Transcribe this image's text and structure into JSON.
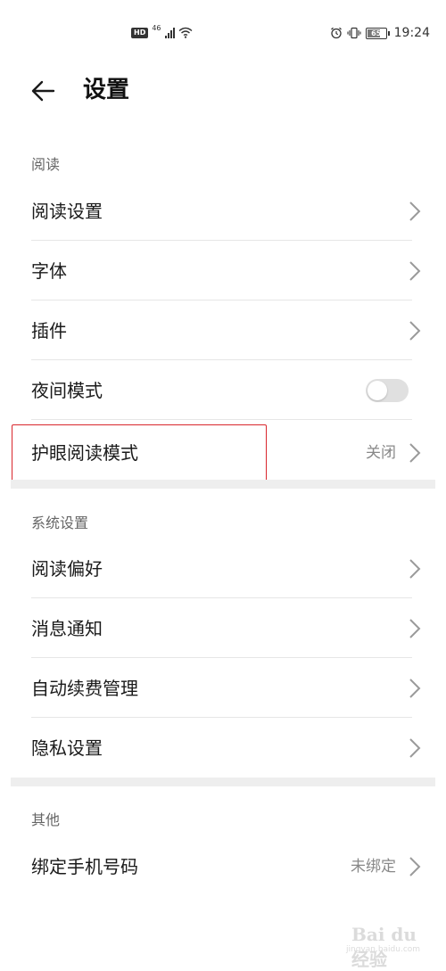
{
  "status_bar": {
    "hd": "HD",
    "network": "46",
    "battery_level": "65",
    "time": "19:24"
  },
  "header": {
    "title": "设置"
  },
  "sections": [
    {
      "label": "阅读",
      "items": [
        {
          "label": "阅读设置",
          "type": "nav"
        },
        {
          "label": "字体",
          "type": "nav"
        },
        {
          "label": "插件",
          "type": "nav"
        },
        {
          "label": "夜间模式",
          "type": "toggle",
          "on": false
        },
        {
          "label": "护眼阅读模式",
          "type": "nav",
          "value": "关闭",
          "highlighted": true
        }
      ]
    },
    {
      "label": "系统设置",
      "items": [
        {
          "label": "阅读偏好",
          "type": "nav"
        },
        {
          "label": "消息通知",
          "type": "nav"
        },
        {
          "label": "自动续费管理",
          "type": "nav"
        },
        {
          "label": "隐私设置",
          "type": "nav"
        }
      ]
    },
    {
      "label": "其他",
      "items": [
        {
          "label": "绑定手机号码",
          "type": "nav",
          "value": "未绑定"
        }
      ]
    }
  ],
  "colors": {
    "highlight": "#d9262c",
    "toggle_off": "#e0e0e0",
    "section_gap": "#eeeeee"
  },
  "watermark": {
    "text": "Bai du 经验",
    "url": "jingyan.baidu.com"
  }
}
